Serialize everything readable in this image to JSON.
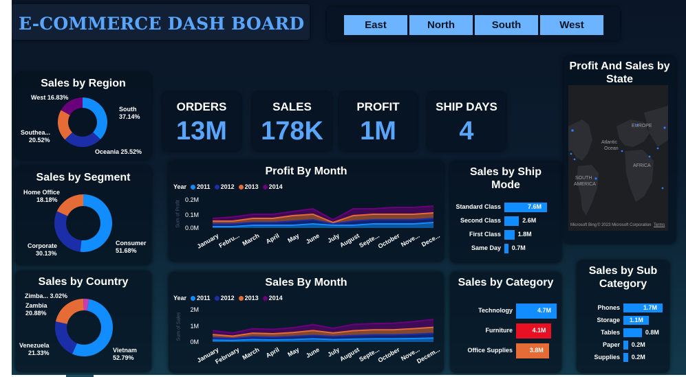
{
  "header": {
    "title": "E-COMMERCE DASH BOARD"
  },
  "slicer": {
    "regions": [
      "East",
      "North",
      "South",
      "West"
    ]
  },
  "kpis": [
    {
      "label": "ORDERS",
      "value": "13M"
    },
    {
      "label": "SALES",
      "value": "178K"
    },
    {
      "label": "PROFIT",
      "value": "1M"
    },
    {
      "label": "SHIP DAYS",
      "value": "4"
    }
  ],
  "colors": {
    "accent": "#5aa6ff",
    "blue_light": "#118dff",
    "navy": "#1b2ea8",
    "orange": "#e66c37",
    "purple": "#6b007b",
    "red": "#e81123"
  },
  "sales_by_region": {
    "title": "Sales by Region",
    "labels": [
      "South 37.14%",
      "Oceania 25.52%",
      "Southea... 20.52%",
      "West 16.83%"
    ],
    "label_lines": [
      [
        "South",
        "37.14%"
      ],
      [
        "Oceania 25.52%"
      ],
      [
        "Southea...",
        "20.52%"
      ],
      [
        "West 16.83%"
      ]
    ]
  },
  "sales_by_segment": {
    "title": "Sales by Segment",
    "label_lines": [
      [
        "Consumer",
        "51.68%"
      ],
      [
        "Corporate",
        "30.13%"
      ],
      [
        "Home Office",
        "18.18%"
      ]
    ]
  },
  "sales_by_country": {
    "title": "Sales by Country",
    "label_lines": [
      [
        "Vietnam",
        "52.79%"
      ],
      [
        "Venezuela",
        "21.33%"
      ],
      [
        "Zambia",
        "20.88%"
      ],
      [
        "Zimba... 3.02%"
      ]
    ]
  },
  "profit_by_month": {
    "title": "Profit By Month",
    "legend_title": "Year",
    "years": [
      "2011",
      "2012",
      "2013",
      "2014"
    ],
    "yticks": [
      "0.2M",
      "0.1M",
      "0.0M"
    ],
    "y_axis_title": "Sum of Profit",
    "months": [
      "January",
      "Febru...",
      "March",
      "April",
      "May",
      "June",
      "July",
      "August",
      "Septe...",
      "October",
      "Nove...",
      "Dece..."
    ]
  },
  "sales_by_month": {
    "title": "Sales By Month",
    "legend_title": "Year",
    "years": [
      "2011",
      "2012",
      "2013",
      "2014"
    ],
    "yticks": [
      "2M",
      "1M",
      "0M"
    ],
    "y_axis_title": "Sum of Sales",
    "months": [
      "January",
      "February",
      "March",
      "April",
      "May",
      "June",
      "July",
      "August",
      "Septe...",
      "October",
      "Nove...",
      "Decem..."
    ]
  },
  "sales_by_ship_mode": {
    "title_lines": [
      "Sales by Ship",
      "Mode"
    ],
    "categories": [
      "Standard Class",
      "Second Class",
      "First Class",
      "Same Day"
    ],
    "value_labels": [
      "7.6M",
      "2.6M",
      "1.8M",
      "0.7M"
    ]
  },
  "sales_by_category": {
    "title": "Sales by Category",
    "categories": [
      "Technology",
      "Furniture",
      "Office Supplies"
    ],
    "value_labels": [
      "4.7M",
      "4.1M",
      "3.8M"
    ]
  },
  "sales_by_sub_category": {
    "title_lines": [
      "Sales by Sub",
      "Category"
    ],
    "categories": [
      "Phones",
      "Storage",
      "Tables",
      "Paper",
      "Supplies"
    ],
    "value_labels": [
      "1.7M",
      "1.1M",
      "0.8M",
      "0.2M",
      "0.2M"
    ]
  },
  "map": {
    "title_lines": [
      "Profit And Sales by",
      "State"
    ],
    "labels": {
      "europe": "EUROPE",
      "atlantic": "Atlantic",
      "ocean": "Ocean",
      "africa": "AFRICA",
      "south": "SOUTH",
      "america": "AMERICA"
    },
    "logo": "Microsoft Bing",
    "copyright": "© 2023 Microsoft Corporation",
    "terms": "Terms"
  },
  "chart_data": [
    {
      "type": "pie",
      "title": "Sales by Region",
      "categories": [
        "South",
        "Oceania",
        "Southea...",
        "West"
      ],
      "values": [
        37.14,
        25.52,
        20.52,
        16.83
      ],
      "colors": [
        "#118dff",
        "#1b2ea8",
        "#e66c37",
        "#6b007b"
      ]
    },
    {
      "type": "pie",
      "title": "Sales by Segment",
      "categories": [
        "Consumer",
        "Corporate",
        "Home Office"
      ],
      "values": [
        51.68,
        30.13,
        18.18
      ],
      "colors": [
        "#118dff",
        "#1b2ea8",
        "#e66c37"
      ]
    },
    {
      "type": "pie",
      "title": "Sales by Country",
      "categories": [
        "Vietnam",
        "Venezuela",
        "Zambia",
        "Zimba..."
      ],
      "values": [
        52.79,
        21.33,
        20.88,
        3.02
      ],
      "colors": [
        "#118dff",
        "#1b2ea8",
        "#e66c37",
        "#c83cb4"
      ]
    },
    {
      "type": "area",
      "title": "Profit By Month",
      "categories": [
        "January",
        "Febru...",
        "March",
        "April",
        "May",
        "June",
        "July",
        "August",
        "Septe...",
        "October",
        "Nove...",
        "Dece..."
      ],
      "ylim": [
        0,
        0.2
      ],
      "yunit": "M",
      "series": [
        {
          "name": "2011",
          "values": [
            0.01,
            0.01,
            0.02,
            0.02,
            0.02,
            0.03,
            0.02,
            0.02,
            0.03,
            0.03,
            0.03,
            0.04
          ]
        },
        {
          "name": "2012",
          "values": [
            0.02,
            0.02,
            0.02,
            0.02,
            0.03,
            0.03,
            0.01,
            0.03,
            0.03,
            0.03,
            0.03,
            0.03
          ]
        },
        {
          "name": "2013",
          "values": [
            0.02,
            0.02,
            0.03,
            0.03,
            0.04,
            0.04,
            0.01,
            0.04,
            0.04,
            0.04,
            0.04,
            0.04
          ]
        },
        {
          "name": "2014",
          "values": [
            0.02,
            0.03,
            0.03,
            0.03,
            0.03,
            0.04,
            0.02,
            0.05,
            0.04,
            0.05,
            0.05,
            0.05
          ]
        }
      ]
    },
    {
      "type": "area",
      "title": "Sales By Month",
      "categories": [
        "January",
        "February",
        "March",
        "April",
        "May",
        "June",
        "July",
        "August",
        "Septe...",
        "October",
        "Nove...",
        "Decem..."
      ],
      "ylim": [
        0,
        2
      ],
      "yunit": "M",
      "series": [
        {
          "name": "2011",
          "values": [
            0.12,
            0.1,
            0.15,
            0.13,
            0.15,
            0.2,
            0.15,
            0.18,
            0.2,
            0.2,
            0.22,
            0.25
          ]
        },
        {
          "name": "2012",
          "values": [
            0.15,
            0.12,
            0.18,
            0.17,
            0.2,
            0.22,
            0.2,
            0.23,
            0.25,
            0.25,
            0.27,
            0.3
          ]
        },
        {
          "name": "2013",
          "values": [
            0.2,
            0.15,
            0.23,
            0.22,
            0.25,
            0.3,
            0.22,
            0.3,
            0.32,
            0.32,
            0.35,
            0.38
          ]
        },
        {
          "name": "2014",
          "values": [
            0.25,
            0.2,
            0.28,
            0.28,
            0.3,
            0.38,
            0.3,
            0.4,
            0.4,
            0.42,
            0.45,
            0.5
          ]
        }
      ]
    },
    {
      "type": "bar",
      "title": "Sales by Ship Mode",
      "categories": [
        "Standard Class",
        "Second Class",
        "First Class",
        "Same Day"
      ],
      "values": [
        7.6,
        2.6,
        1.8,
        0.7
      ],
      "unit": "M"
    },
    {
      "type": "bar",
      "title": "Sales by Category",
      "categories": [
        "Technology",
        "Furniture",
        "Office Supplies"
      ],
      "values": [
        4.7,
        4.1,
        3.8
      ],
      "unit": "M",
      "colors": [
        "#118dff",
        "#e81123",
        "#e66c37"
      ]
    },
    {
      "type": "bar",
      "title": "Sales by Sub Category",
      "categories": [
        "Phones",
        "Storage",
        "Tables",
        "Paper",
        "Supplies"
      ],
      "values": [
        1.7,
        1.1,
        0.8,
        0.2,
        0.2
      ],
      "unit": "M"
    }
  ]
}
